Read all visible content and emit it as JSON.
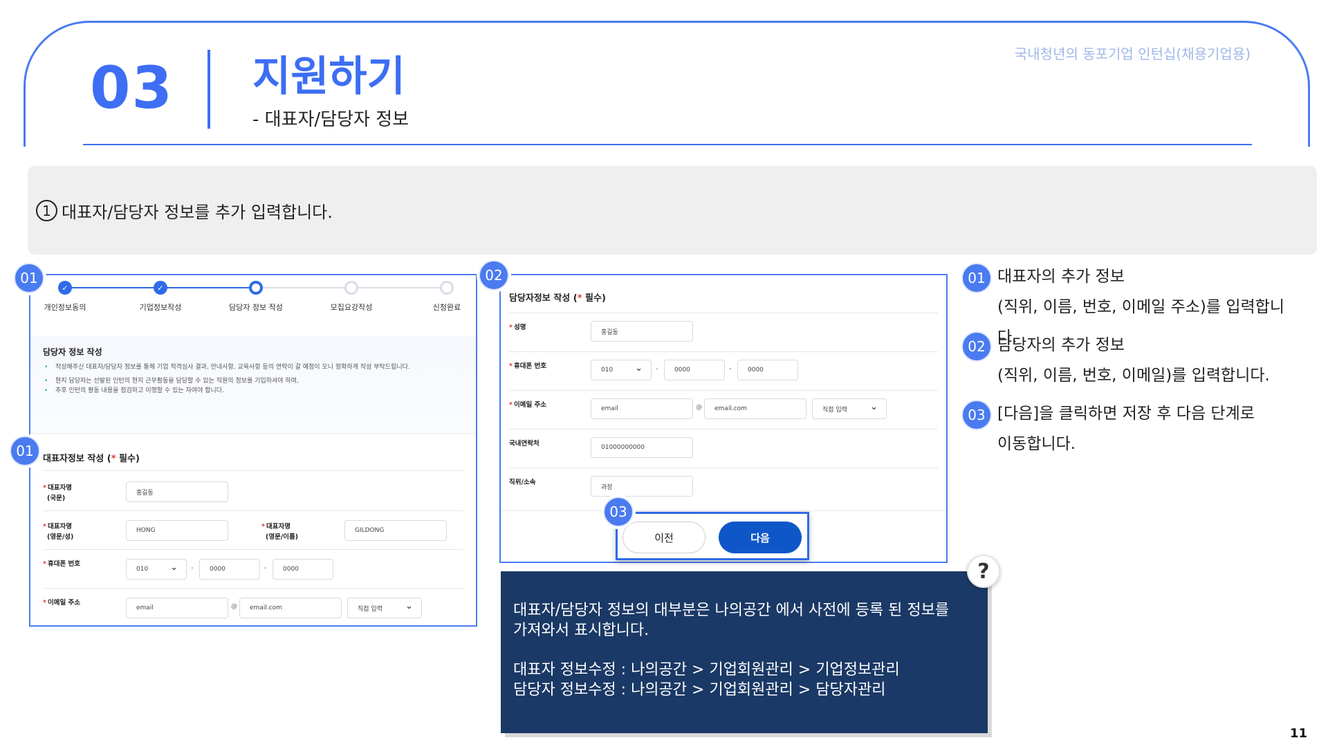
{
  "header": {
    "section_number": "03",
    "title": "지원하기",
    "subtitle": "- 대표자/담당자 정보",
    "doc_label": "국내청년의 동포기업 인턴십(채용기업용)"
  },
  "instruction": {
    "number": "1",
    "text": "대표자/담당자 정보를 추가 입력합니다."
  },
  "panel_a": {
    "badge_top": "01",
    "badge_form": "01",
    "steps": [
      "개인정보동의",
      "기업정보작성",
      "담당자 정보 작성",
      "모집요강작성",
      "신청완료"
    ],
    "check_mark": "✓",
    "notice": {
      "title": "담당자 정보 작성",
      "lines": [
        "작성해주신 대표자/담당자 정보를 통해 기업 적격심사 결과, 안내사항, 교육사항 등의 연락이 갈 예정이 오니 정확하게 작성 부탁드립니다.",
        "현지 담당자는 선발된 인턴의 현지 근무활동을 담당할 수 있는 직원의 정보를 기입하셔야 하며,",
        "추후 인턴의 활동 내용을 점검하고 이행할 수 있는 자여야 합니다."
      ]
    },
    "form": {
      "title": "대표자정보 작성 (",
      "required_mark": "*",
      "title_suffix": " 필수)",
      "name_kr_label_1": "대표자명",
      "name_kr_label_2": "(국문)",
      "name_kr_value": "홍길동",
      "name_en_last_label_1": "대표자명",
      "name_en_last_label_2": "(영문/성)",
      "name_en_last_value": "HONG",
      "name_en_first_label_1": "대표자명",
      "name_en_first_label_2": "(영문/이름)",
      "name_en_first_value": "GILDONG",
      "phone_label": "휴대폰 번호",
      "phone_prefix": "010",
      "phone_mid": "0000",
      "phone_last": "0000",
      "dash": "-",
      "email_label": "이메일 주소",
      "email_id": "email",
      "at": "@",
      "email_domain": "email.com",
      "email_select": "직접 입력"
    }
  },
  "panel_b": {
    "badge": "02",
    "form": {
      "title": "담당자정보 작성 (",
      "required_mark": "*",
      "title_suffix": " 필수)",
      "name_label": "성명",
      "name_value": "홍길동",
      "phone_label": "휴대폰 번호",
      "phone_prefix": "010",
      "phone_mid": "0000",
      "phone_last": "0000",
      "dash": "-",
      "email_label": "이메일 주소",
      "email_id": "email",
      "at": "@",
      "email_domain": "email.com",
      "email_select": "직접 입력",
      "domestic_label": "국내연락처",
      "domestic_value": "01000000000",
      "position_label": "직위/소속",
      "position_value": "과장"
    }
  },
  "buttons": {
    "badge": "03",
    "prev_label": "이전",
    "next_label": "다음"
  },
  "descriptions": [
    {
      "badge": "01",
      "line1": "대표자의 추가 정보",
      "line2": "(직위, 이름, 번호, 이메일 주소)를 입력합니다."
    },
    {
      "badge": "02",
      "line1": "담당자의 추가 정보",
      "line2": "(직위, 이름, 번호, 이메일)를 입력합니다."
    },
    {
      "badge": "03",
      "line1": "[다음]을 클릭하면 저장 후 다음 단계로",
      "line2": "이동합니다."
    }
  ],
  "info_box": {
    "line1": "대표자/담당자 정보의 대부분은 나의공간 에서 사전에 등록 된 정보를",
    "line2": "가져와서 표시합니다.",
    "line3": "대표자 정보수정 : 나의공간 > 기업회원관리 > 기업정보관리",
    "line4": "담당자 정보수정 : 나의공간 > 기업회원관리 > 담당자관리",
    "help_glyph": "?"
  },
  "page_number": "11",
  "colors": {
    "accent": "#3d6ef3",
    "info_bg": "#1b3966",
    "next_button": "#0f57c9",
    "required": "#e23a3a"
  }
}
